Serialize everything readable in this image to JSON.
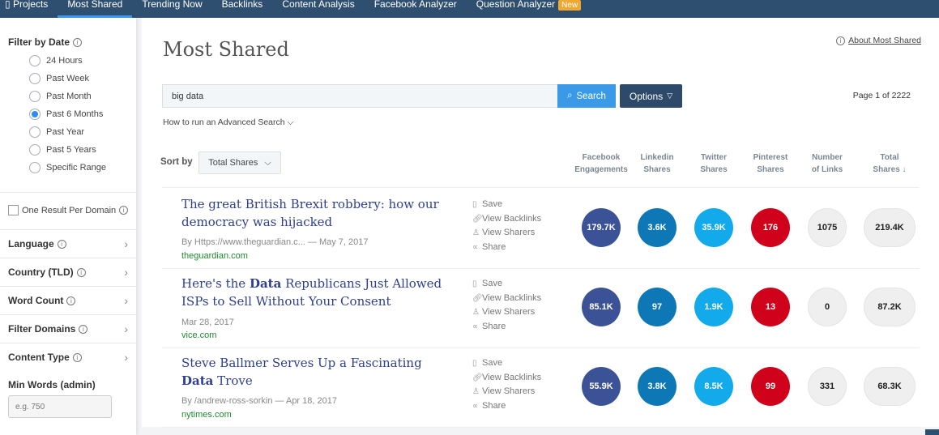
{
  "nav": {
    "items": [
      {
        "label": "Projects"
      },
      {
        "label": "Most Shared"
      },
      {
        "label": "Trending Now"
      },
      {
        "label": "Backlinks"
      },
      {
        "label": "Content Analysis"
      },
      {
        "label": "Facebook Analyzer"
      },
      {
        "label": "Question Analyzer"
      }
    ],
    "badge": "New",
    "active": "Most Shared"
  },
  "sidebar": {
    "filter_date": "Filter by Date",
    "date_options": [
      {
        "label": "24 Hours",
        "checked": false
      },
      {
        "label": "Past Week",
        "checked": false
      },
      {
        "label": "Past Month",
        "checked": false
      },
      {
        "label": "Past 6 Months",
        "checked": true
      },
      {
        "label": "Past Year",
        "checked": false
      },
      {
        "label": "Past 5 Years",
        "checked": false
      },
      {
        "label": "Specific Range",
        "checked": false
      }
    ],
    "one_result": "One Result Per Domain",
    "sections": [
      {
        "label": "Language"
      },
      {
        "label": "Country (TLD)"
      },
      {
        "label": "Word Count"
      },
      {
        "label": "Filter Domains"
      },
      {
        "label": "Content Type"
      }
    ],
    "min_words": "Min Words (admin)",
    "min_words_placeholder": "e.g. 750"
  },
  "main": {
    "title": "Most Shared",
    "about": "About Most Shared",
    "search_value": "big data",
    "search_btn": "Search",
    "options_btn": "Options",
    "page": "Page 1 of 2222",
    "advanced": "How to run an Advanced Search",
    "sort_label": "Sort by",
    "sort_value": "Total Shares",
    "columns": [
      {
        "l1": "Facebook",
        "l2": "Engagements"
      },
      {
        "l1": "Linkedin",
        "l2": "Shares"
      },
      {
        "l1": "Twitter",
        "l2": "Shares"
      },
      {
        "l1": "Pinterest",
        "l2": "Shares"
      },
      {
        "l1": "Number",
        "l2": "of Links"
      },
      {
        "l1": "Total",
        "l2": "Shares ↓"
      }
    ],
    "actions": {
      "save": "Save",
      "backlinks": "View Backlinks",
      "sharers": "View Sharers",
      "share": "Share"
    },
    "colors": {
      "facebook": "#3b5296",
      "linkedin": "#0e77b5",
      "twitter": "#12aaeb",
      "pinterest": "#d0021b",
      "neutral": "#efefef"
    },
    "results": [
      {
        "title": [
          {
            "t": "The great British Brexit robbery: how our democracy was hijacked",
            "b": false
          }
        ],
        "meta": "By Https://www.theguardian.c... — May 7, 2017",
        "domain": "theguardian.com",
        "fb": "179.7K",
        "li": "3.6K",
        "tw": "35.9K",
        "pi": "176",
        "links": "1075",
        "total": "219.4K"
      },
      {
        "title": [
          {
            "t": "Here's the ",
            "b": false
          },
          {
            "t": "Data",
            "b": true
          },
          {
            "t": " Republicans Just Allowed ISPs to Sell Without Your Consent",
            "b": false
          }
        ],
        "meta": "Mar 28, 2017",
        "domain": "vice.com",
        "fb": "85.1K",
        "li": "97",
        "tw": "1.9K",
        "pi": "13",
        "links": "0",
        "total": "87.2K"
      },
      {
        "title": [
          {
            "t": "Steve Ballmer Serves Up a Fascinating ",
            "b": false
          },
          {
            "t": "Data",
            "b": true
          },
          {
            "t": " Trove",
            "b": false
          }
        ],
        "meta": "By /andrew-ross-sorkin — Apr 18, 2017",
        "domain": "nytimes.com",
        "fb": "55.9K",
        "li": "3.8K",
        "tw": "8.5K",
        "pi": "99",
        "links": "331",
        "total": "68.3K"
      }
    ]
  }
}
